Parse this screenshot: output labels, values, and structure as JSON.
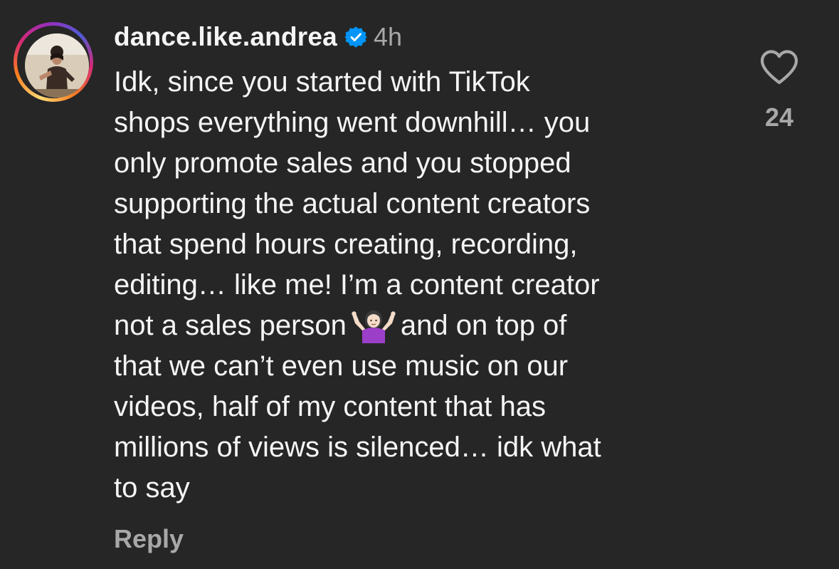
{
  "comment": {
    "username": "dance.like.andrea",
    "verified_icon": "verified-badge-icon",
    "time": "4h",
    "body_lines": [
      "Idk, since you started with TikTok",
      "shops everything went downhill… you",
      "only promote sales and you stopped",
      "supporting the actual content creators",
      "that spend hours creating, recording,",
      "editing… like me! I’m a content creator",
      "not a sales person",
      "and on top of",
      "that we can’t even use music on our",
      "videos, half of my content that has",
      "millions of views is silenced… idk what",
      "to say"
    ],
    "emoji_icon": "woman-shrugging-emoji",
    "reply_label": "Reply",
    "like_icon": "heart-outline-icon",
    "like_count": "24"
  },
  "colors": {
    "background": "#262626",
    "text": "#f5f5f5",
    "secondary": "#a8a8a8",
    "verified": "#0095f6"
  }
}
